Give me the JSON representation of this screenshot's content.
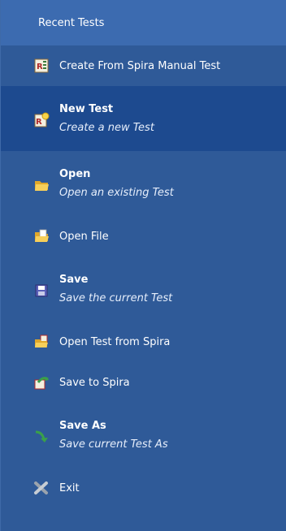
{
  "header": {
    "title": "Recent Tests"
  },
  "items": [
    {
      "label": "Create From Spira Manual Test",
      "icon": "spira-manual-test-icon"
    },
    {
      "title": "New Test",
      "description": "Create a new Test",
      "icon": "new-test-icon",
      "selected": true
    },
    {
      "title": "Open",
      "description": "Open an existing Test",
      "icon": "folder-open-icon"
    },
    {
      "label": "Open File",
      "icon": "open-file-icon"
    },
    {
      "title": "Save",
      "description": "Save the current Test",
      "icon": "save-icon"
    },
    {
      "label": "Open Test from Spira",
      "icon": "open-from-spira-icon"
    },
    {
      "label": "Save to Spira",
      "icon": "save-to-spira-icon"
    },
    {
      "title": "Save As",
      "description": "Save current Test As",
      "icon": "save-as-arrow-icon"
    },
    {
      "label": "Exit",
      "icon": "exit-x-icon"
    }
  ],
  "colors": {
    "background": "#2f5a98",
    "header": "#3c6bb0",
    "selected": "#1d4a8f"
  }
}
